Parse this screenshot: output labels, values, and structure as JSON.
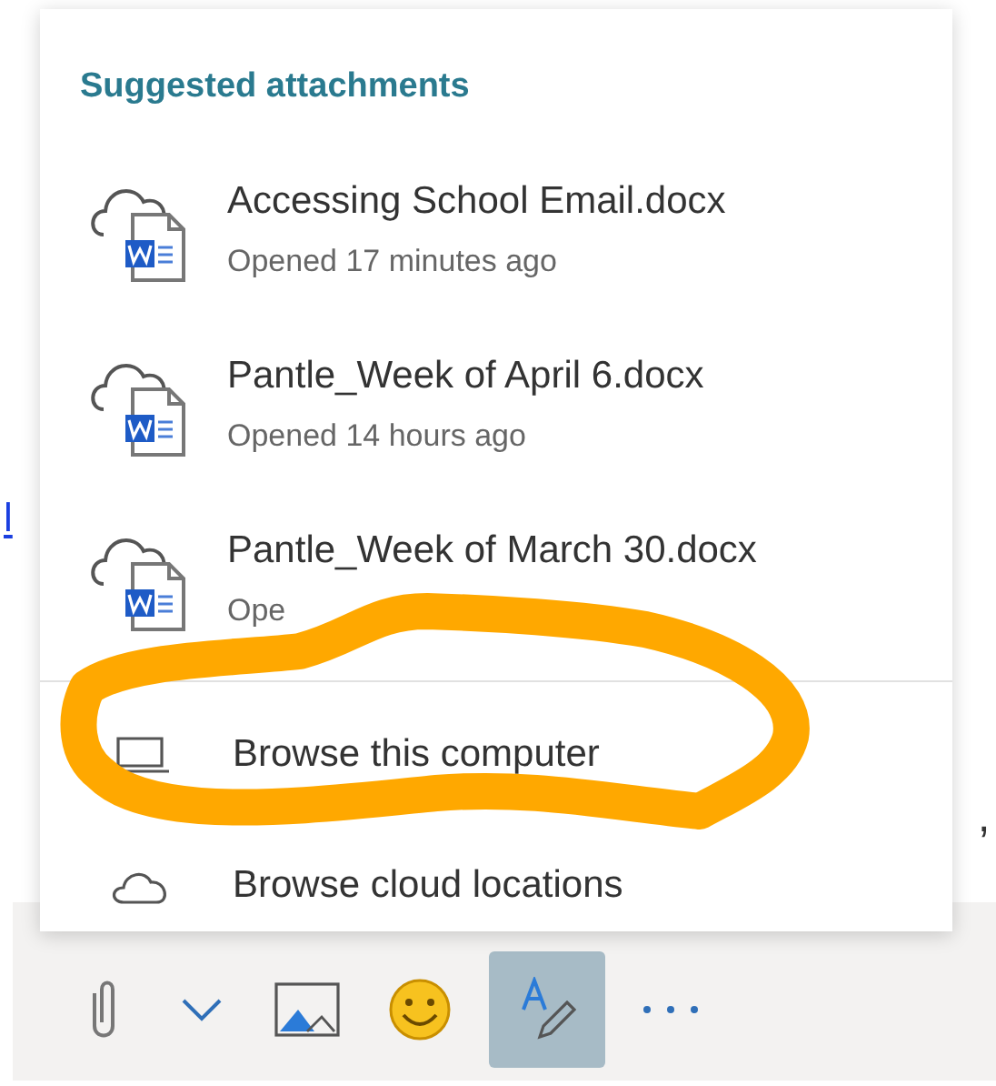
{
  "background": {
    "link_fragment": "l",
    "trailing_text": ","
  },
  "menu": {
    "heading": "Suggested attachments",
    "files": [
      {
        "name": "Accessing School Email.docx",
        "detail": "Opened 17 minutes ago"
      },
      {
        "name": "Pantle_Week of April 6.docx",
        "detail": "Opened 14 hours ago"
      },
      {
        "name": "Pantle_Week of March 30.docx",
        "detail": "Ope"
      }
    ],
    "actions": [
      {
        "kind": "computer",
        "label": "Browse this computer"
      },
      {
        "kind": "cloud",
        "label": "Browse cloud locations"
      }
    ]
  },
  "toolbar": [
    {
      "kind": "attach",
      "selected": false
    },
    {
      "kind": "chevron",
      "selected": false
    },
    {
      "kind": "image",
      "selected": false
    },
    {
      "kind": "emoji",
      "selected": false
    },
    {
      "kind": "format",
      "selected": true
    },
    {
      "kind": "more",
      "selected": false
    }
  ],
  "annotation": {
    "kind": "ellipse",
    "color": "#ffa800"
  }
}
